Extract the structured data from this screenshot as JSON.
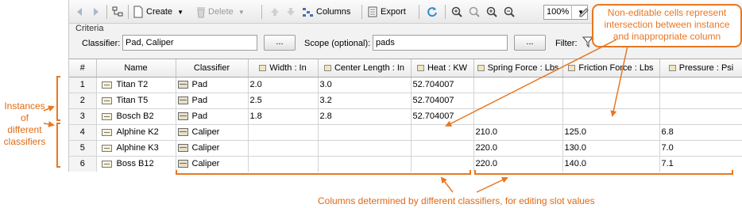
{
  "toolbar": {
    "create_label": "Create",
    "delete_label": "Delete",
    "columns_label": "Columns",
    "export_label": "Export",
    "zoom_value": "100%",
    "icons": [
      "back-icon",
      "forward-icon",
      "tree-icon",
      "create-icon",
      "delete-icon",
      "move-up-icon",
      "move-down-icon",
      "columns-icon",
      "export-icon",
      "refresh-icon",
      "zoom-in-icon",
      "zoom-out-icon",
      "zoom-fit-icon",
      "zoom-reset-icon",
      "edit-icon"
    ]
  },
  "criteria": {
    "title": "Criteria",
    "classifier_label": "Classifier:",
    "classifier_value": "Pad, Caliper",
    "classifier_button": "...",
    "scope_label": "Scope (optional):",
    "scope_value": "pads",
    "scope_button": "...",
    "filter_label": "Filter:"
  },
  "table": {
    "headers": [
      "#",
      "Name",
      "Classifier",
      "Width : In",
      "Center Length : In",
      "Heat : KW",
      "Spring Force : Lbs",
      "Friction Force : Lbs",
      "Pressure : Psi"
    ],
    "rows": [
      {
        "num": "1",
        "name": "Titan T2",
        "classifier": "Pad",
        "width": "2.0",
        "center": "3.0",
        "heat": "52.704007",
        "spring": "",
        "friction": "",
        "pressure": ""
      },
      {
        "num": "2",
        "name": "Titan T5",
        "classifier": "Pad",
        "width": "2.5",
        "center": "3.2",
        "heat": "52.704007",
        "spring": "",
        "friction": "",
        "pressure": ""
      },
      {
        "num": "3",
        "name": "Bosch B2",
        "classifier": "Pad",
        "width": "1.8",
        "center": "2.8",
        "heat": "52.704007",
        "spring": "",
        "friction": "",
        "pressure": ""
      },
      {
        "num": "4",
        "name": "Alphine K2",
        "classifier": "Caliper",
        "width": "",
        "center": "",
        "heat": "",
        "spring": "210.0",
        "friction": "125.0",
        "pressure": "6.8"
      },
      {
        "num": "5",
        "name": "Alphine K3",
        "classifier": "Caliper",
        "width": "",
        "center": "",
        "heat": "",
        "spring": "220.0",
        "friction": "130.0",
        "pressure": "7.0"
      },
      {
        "num": "6",
        "name": "Boss B12",
        "classifier": "Caliper",
        "width": "",
        "center": "",
        "heat": "",
        "spring": "220.0",
        "friction": "140.0",
        "pressure": "7.1"
      }
    ]
  },
  "annotations": {
    "instances_l1": "Instances",
    "instances_l2": "of",
    "instances_l3": "different",
    "instances_l4": "classifiers",
    "callout_l1": "Non-editable cells represent",
    "callout_l2": "intersection between instance",
    "callout_l3": "and inappropriate column",
    "columns_note": "Columns determined by different classifiers, for editing slot values"
  },
  "colors": {
    "annotation": "#e87722"
  }
}
